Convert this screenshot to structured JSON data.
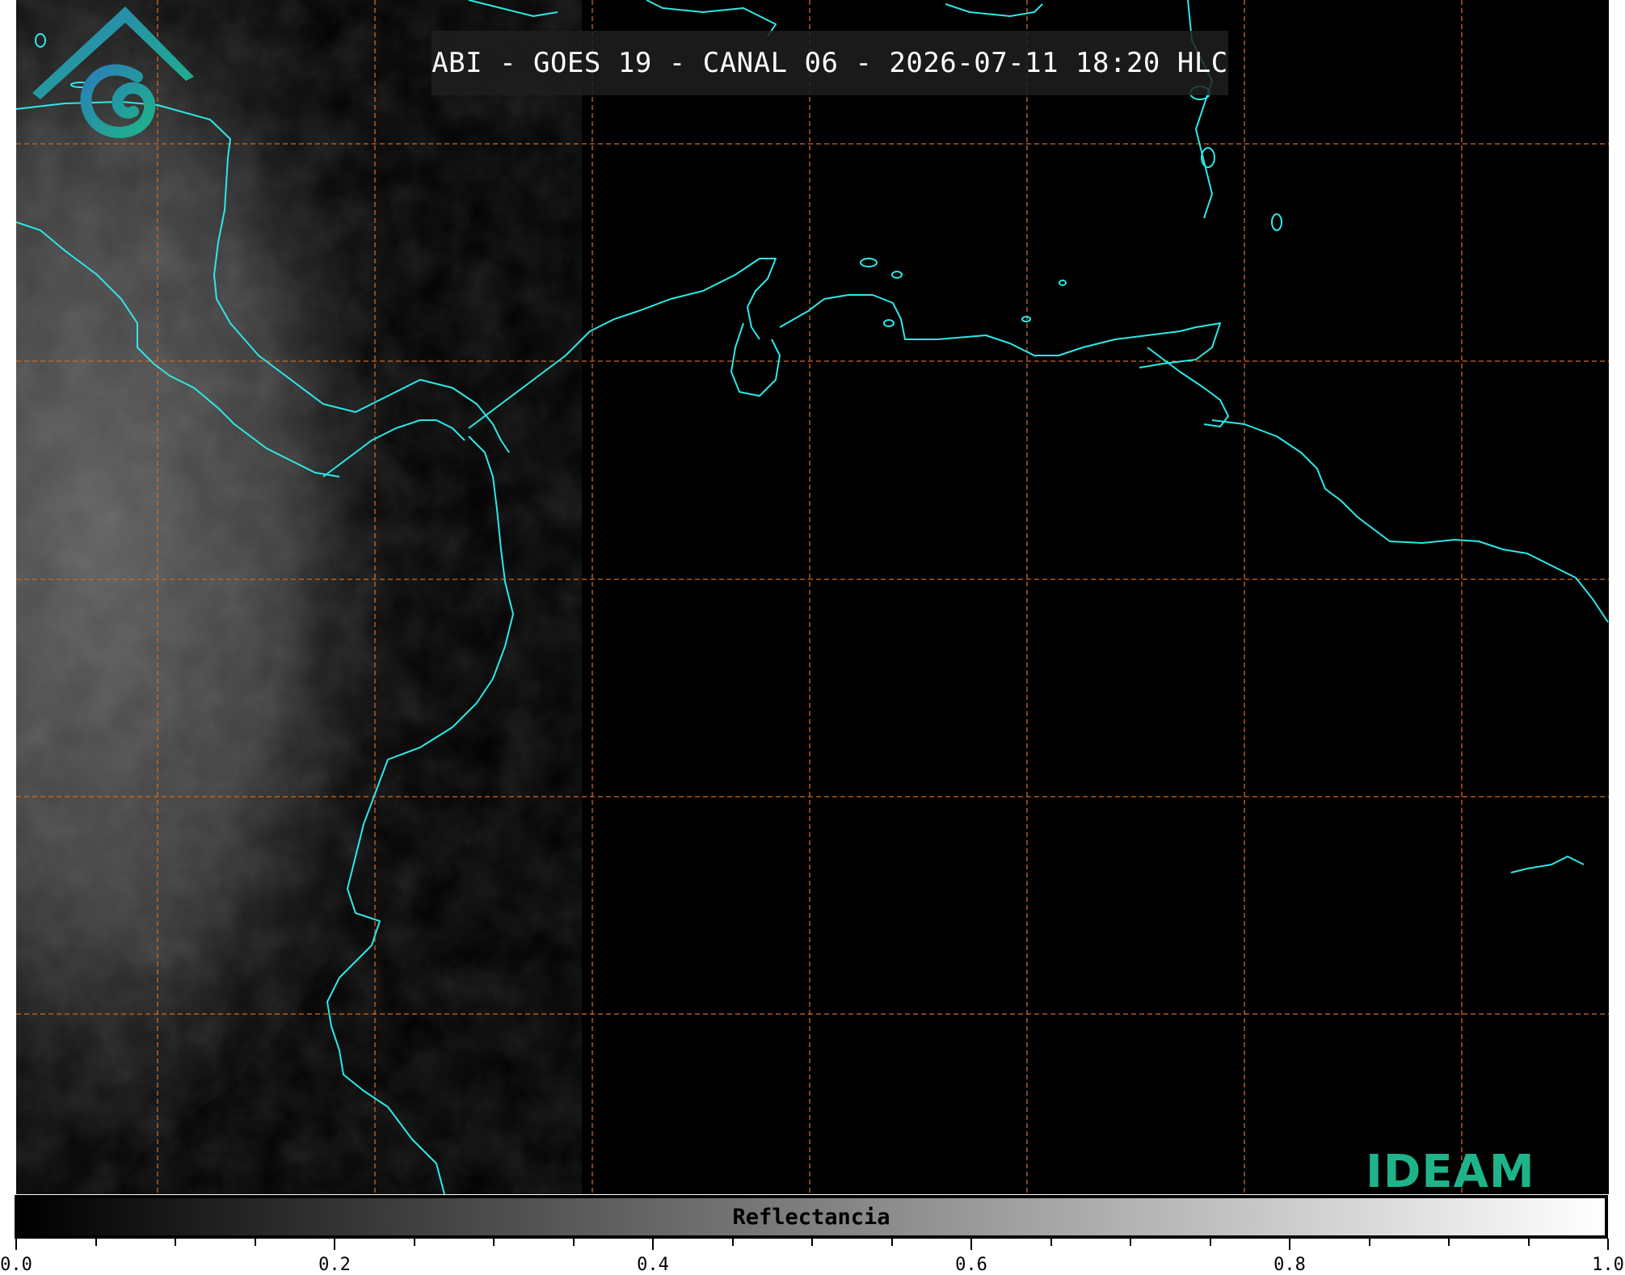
{
  "title": "ABI - GOES 19 - CANAL 06 - 2026-07-11 18:20 HLC",
  "logo": {
    "text": "IDEAM"
  },
  "colorbar": {
    "label": "Reflectancia",
    "range": [
      0.0,
      1.0
    ],
    "colors": [
      "#000000",
      "#ffffff"
    ],
    "tick_labels": [
      "0.0",
      "0.2",
      "0.4",
      "0.6",
      "0.8",
      "1.0"
    ],
    "minor_tick_step": 0.05
  },
  "colors": {
    "coastline": "#2ee8e8",
    "grid": "#d2691e",
    "cloud_gray": "#5a5a5a",
    "logo_teal": "#1fb38a",
    "logo_blue": "#2a7fb8"
  },
  "map": {
    "grid": true,
    "grid_style": "dashed"
  }
}
